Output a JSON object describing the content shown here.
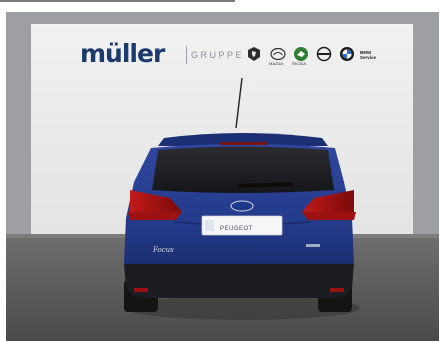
{
  "sign": {
    "wordmark": "müller",
    "subtitle": "GRUPPE",
    "logos": [
      {
        "icon": "peugeot-lion-icon",
        "caption": ""
      },
      {
        "icon": "mazda-icon",
        "caption": "MAZDA"
      },
      {
        "icon": "skoda-icon",
        "caption": "ŠKODA"
      },
      {
        "icon": "opel-icon",
        "caption": ""
      },
      {
        "icon": "bmw-icon",
        "caption": ""
      }
    ],
    "bmw_service_line1": "BMW",
    "bmw_service_line2": "Service"
  },
  "car": {
    "make_badge": "Ford",
    "model_badge": "Focus",
    "plate_text": "PEUGEOT",
    "body_color": "#2a3f8f"
  }
}
